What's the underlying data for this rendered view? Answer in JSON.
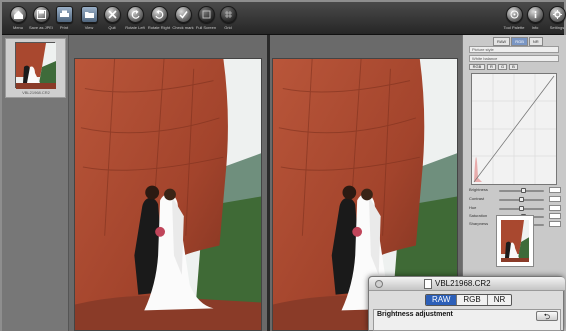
{
  "toolbar": {
    "left_buttons": [
      {
        "label": "Menu",
        "icon": "home-icon"
      },
      {
        "label": "Save as JPEG",
        "icon": "save-icon"
      },
      {
        "label": "Print",
        "icon": "print-icon"
      },
      {
        "label": "View",
        "icon": "folder-icon"
      },
      {
        "label": "Quit",
        "icon": "close-icon"
      },
      {
        "label": "Rotate Left",
        "icon": "rotate-left-icon"
      },
      {
        "label": "Rotate Right",
        "icon": "rotate-right-icon"
      },
      {
        "label": "Check mark",
        "icon": "check-icon"
      },
      {
        "label": "Full Screen",
        "icon": "fullscreen-icon"
      },
      {
        "label": "Grid",
        "icon": "grid-icon"
      }
    ],
    "right_buttons": [
      {
        "label": "Tool Palette",
        "icon": "palette-icon"
      },
      {
        "label": "Info",
        "icon": "info-icon"
      },
      {
        "label": "Settings",
        "icon": "gear-icon"
      }
    ]
  },
  "filmstrip": {
    "items": [
      {
        "name": "VBL21968.CR2",
        "selected": true
      }
    ]
  },
  "panel": {
    "tabs": [
      "RAW",
      "RGB",
      "NR"
    ],
    "active_tab": "RGB",
    "field1": "Picture style",
    "field2": "White balance",
    "curve_buttons": [
      "RGB",
      "R",
      "G",
      "B"
    ],
    "sliders": [
      {
        "label": "Brightness",
        "value": 0.55
      },
      {
        "label": "Contrast",
        "value": 0.5
      },
      {
        "label": "Hue",
        "value": 0.5
      },
      {
        "label": "Saturation",
        "value": 0.55
      },
      {
        "label": "Sharpness",
        "value": 0.35
      }
    ]
  },
  "dialog": {
    "filename": "VBL21968.CR2",
    "tabs": [
      "RAW",
      "RGB",
      "NR"
    ],
    "active_tab": "RAW",
    "section_title": "Brightness adjustment",
    "undo_glyph": "⮌"
  },
  "colors": {
    "toolbar": "#333333",
    "workspace": "#6a6a6a",
    "panel": "#c9c9c9",
    "accent": "#2c5fb8",
    "rock": "#a9482f",
    "sky": "#eef1f0"
  }
}
